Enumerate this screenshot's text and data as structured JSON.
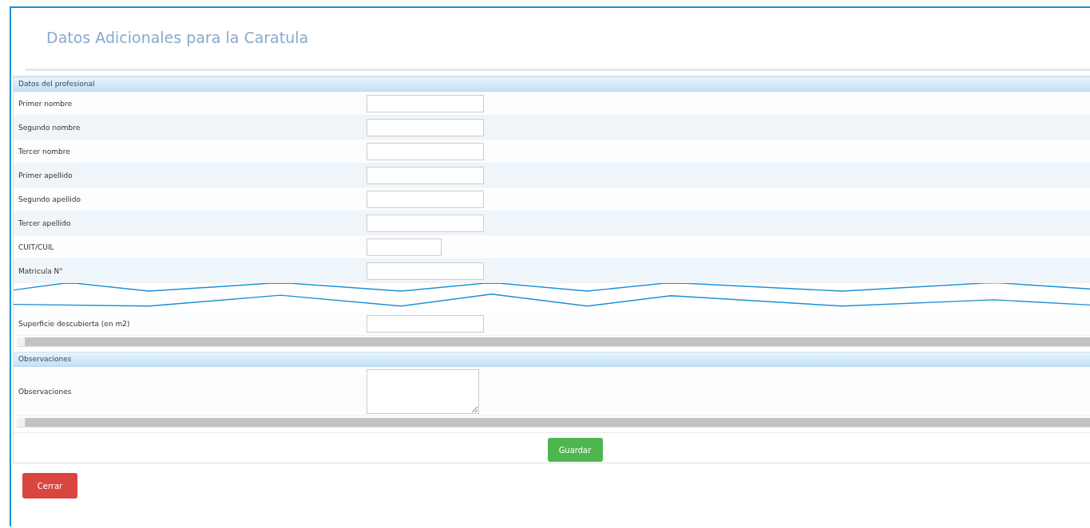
{
  "title": "Datos Adicionales para la Caratula",
  "sections": [
    {
      "header": "Datos del profesional",
      "rows_before_break": [
        {
          "label": "Primer nombre",
          "kind": "text"
        },
        {
          "label": "Segundo nombre",
          "kind": "text"
        },
        {
          "label": "Tercer nombre",
          "kind": "text"
        },
        {
          "label": "Primer apellido",
          "kind": "text"
        },
        {
          "label": "Segundo apellido",
          "kind": "text"
        },
        {
          "label": "Tercer apellido",
          "kind": "text"
        },
        {
          "label": "CUIT/CUIL",
          "kind": "short"
        },
        {
          "label": "Matricula N°",
          "kind": "text"
        }
      ],
      "rows_after_break": [
        {
          "label": "Superficie descubierta (en m2)",
          "kind": "text"
        }
      ]
    },
    {
      "header": "Observaciones",
      "rows_before_break": [
        {
          "label": "Observaciones",
          "kind": "textarea"
        }
      ]
    }
  ],
  "save_button": "Guardar",
  "close_button": "Cerrar"
}
